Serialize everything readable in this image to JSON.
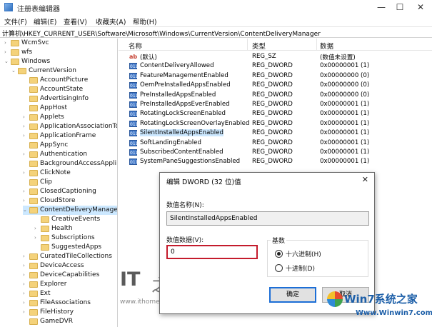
{
  "window": {
    "title": "注册表编辑器",
    "min_glyph": "—",
    "max_glyph": "☐",
    "close_glyph": "✕"
  },
  "menu": [
    "文件(F)",
    "编辑(E)",
    "查看(V)",
    "收藏夹(A)",
    "帮助(H)"
  ],
  "address": "计算机\\HKEY_CURRENT_USER\\Software\\Microsoft\\Windows\\CurrentVersion\\ContentDeliveryManager",
  "tree": [
    {
      "label": "WcmSvc",
      "chevron": "›",
      "folder": true
    },
    {
      "label": "wfs",
      "chevron": "›",
      "folder": true
    },
    {
      "label": "Windows",
      "chevron": "⌄",
      "folder": true
    },
    {
      "label": "CurrentVersion",
      "chevron": "⌄",
      "folder": true
    },
    {
      "label": "AccountPicture",
      "chevron": "",
      "folder": true
    },
    {
      "label": "AccountState",
      "chevron": "",
      "folder": true
    },
    {
      "label": "AdvertisingInfo",
      "chevron": "",
      "folder": true
    },
    {
      "label": "AppHost",
      "chevron": "",
      "folder": true
    },
    {
      "label": "Applets",
      "chevron": "›",
      "folder": true
    },
    {
      "label": "ApplicationAssociationTo",
      "chevron": "›",
      "folder": true
    },
    {
      "label": "ApplicationFrame",
      "chevron": "›",
      "folder": true
    },
    {
      "label": "AppSync",
      "chevron": "",
      "folder": true
    },
    {
      "label": "Authentication",
      "chevron": "›",
      "folder": true
    },
    {
      "label": "BackgroundAccessAppli",
      "chevron": "",
      "folder": true
    },
    {
      "label": "ClickNote",
      "chevron": "›",
      "folder": true
    },
    {
      "label": "Clip",
      "chevron": "",
      "folder": true
    },
    {
      "label": "ClosedCaptioning",
      "chevron": "›",
      "folder": true
    },
    {
      "label": "CloudStore",
      "chevron": "›",
      "folder": true
    },
    {
      "label": "ContentDeliveryManager",
      "chevron": "⌄",
      "folder": true,
      "selected": true
    },
    {
      "label": "CreativeEvents",
      "chevron": "",
      "folder": true
    },
    {
      "label": "Health",
      "chevron": "›",
      "folder": true
    },
    {
      "label": "Subscriptions",
      "chevron": "›",
      "folder": true
    },
    {
      "label": "SuggestedApps",
      "chevron": "",
      "folder": true
    },
    {
      "label": "CuratedTileCollections",
      "chevron": "›",
      "folder": true
    },
    {
      "label": "DeviceAccess",
      "chevron": "›",
      "folder": true
    },
    {
      "label": "DeviceCapabilities",
      "chevron": "›",
      "folder": true
    },
    {
      "label": "Explorer",
      "chevron": "›",
      "folder": true
    },
    {
      "label": "Ext",
      "chevron": "›",
      "folder": true
    },
    {
      "label": "FileAssociations",
      "chevron": "›",
      "folder": true
    },
    {
      "label": "FileHistory",
      "chevron": "›",
      "folder": true
    },
    {
      "label": "GameDVR",
      "chevron": "",
      "folder": true
    }
  ],
  "columns": {
    "name": "名称",
    "type": "类型",
    "data": "数据"
  },
  "values": [
    {
      "icon": "string-value-icon",
      "glyph": "ab",
      "name": "(默认)",
      "type": "REG_SZ",
      "data": "(数值未设置)"
    },
    {
      "icon": "dword-value-icon",
      "glyph": "011",
      "name": "ContentDeliveryAllowed",
      "type": "REG_DWORD",
      "data": "0x00000001 (1)"
    },
    {
      "icon": "dword-value-icon",
      "glyph": "011",
      "name": "FeatureManagementEnabled",
      "type": "REG_DWORD",
      "data": "0x00000000 (0)"
    },
    {
      "icon": "dword-value-icon",
      "glyph": "011",
      "name": "OemPreInstalledAppsEnabled",
      "type": "REG_DWORD",
      "data": "0x00000000 (0)"
    },
    {
      "icon": "dword-value-icon",
      "glyph": "011",
      "name": "PreInstalledAppsEnabled",
      "type": "REG_DWORD",
      "data": "0x00000000 (0)"
    },
    {
      "icon": "dword-value-icon",
      "glyph": "011",
      "name": "PreInstalledAppsEverEnabled",
      "type": "REG_DWORD",
      "data": "0x00000001 (1)"
    },
    {
      "icon": "dword-value-icon",
      "glyph": "011",
      "name": "RotatingLockScreenEnabled",
      "type": "REG_DWORD",
      "data": "0x00000001 (1)"
    },
    {
      "icon": "dword-value-icon",
      "glyph": "011",
      "name": "RotatingLockScreenOverlayEnabled",
      "type": "REG_DWORD",
      "data": "0x00000001 (1)"
    },
    {
      "icon": "dword-value-icon",
      "glyph": "011",
      "name": "SilentInstalledAppsEnabled",
      "type": "REG_DWORD",
      "data": "0x00000001 (1)",
      "highlight": true
    },
    {
      "icon": "dword-value-icon",
      "glyph": "011",
      "name": "SoftLandingEnabled",
      "type": "REG_DWORD",
      "data": "0x00000001 (1)"
    },
    {
      "icon": "dword-value-icon",
      "glyph": "011",
      "name": "SubscribedContentEnabled",
      "type": "REG_DWORD",
      "data": "0x00000001 (1)"
    },
    {
      "icon": "dword-value-icon",
      "glyph": "011",
      "name": "SystemPaneSuggestionsEnabled",
      "type": "REG_DWORD",
      "data": "0x00000001 (1)"
    }
  ],
  "dialog": {
    "title": "编辑 DWORD (32 位)值",
    "close_glyph": "✕",
    "value_name_label": "数值名称(N):",
    "value_name": "SilentInstalledAppsEnabled",
    "value_data_label": "数值数据(V):",
    "value_data": "0",
    "base_label": "基数",
    "radio_hex": "十六进制(H)",
    "radio_dec": "十进制(D)",
    "selected_base": "hex",
    "ok_label": "确定",
    "cancel_label": "取消"
  },
  "watermarks": {
    "ithome_logo": "IT",
    "ithome_logo_char": "之",
    "ithome_url": "www.ithome.com",
    "win7_title": "Win7系统之家",
    "win7_url": "Www.Winwin7.com"
  },
  "colors": {
    "selection": "#cce8ff",
    "edit_border": "#c41b2c",
    "dword_icon": "#3e76c7",
    "folder": "#f4d27a"
  }
}
